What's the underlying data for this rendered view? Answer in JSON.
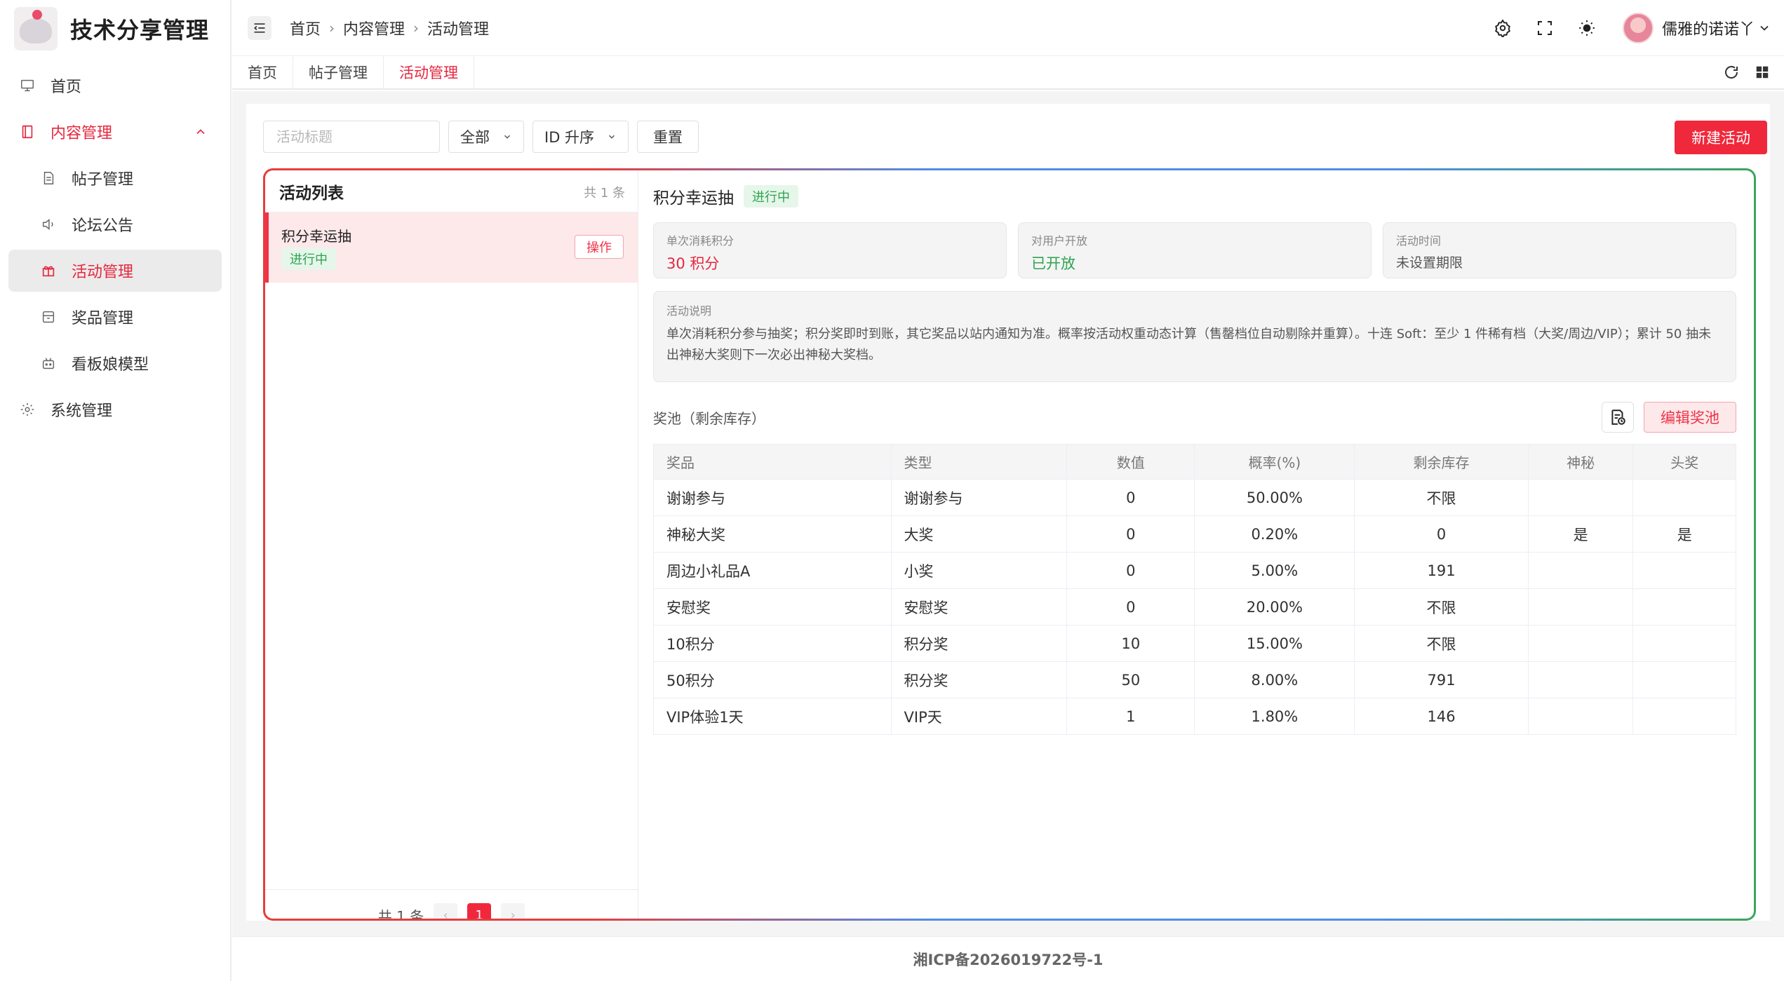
{
  "app": {
    "title": "技术分享管理"
  },
  "sidebar": {
    "items": [
      {
        "label": "首页"
      },
      {
        "label": "内容管理"
      },
      {
        "label": "帖子管理"
      },
      {
        "label": "论坛公告"
      },
      {
        "label": "活动管理"
      },
      {
        "label": "奖品管理"
      },
      {
        "label": "看板娘模型"
      },
      {
        "label": "系统管理"
      }
    ]
  },
  "header": {
    "breadcrumb": [
      "首页",
      "内容管理",
      "活动管理"
    ],
    "username": "儒雅的诺诺丫"
  },
  "tabs": [
    "首页",
    "帖子管理",
    "活动管理"
  ],
  "filters": {
    "search_placeholder": "活动标题",
    "status_select": "全部",
    "sort_select": "ID 升序",
    "reset_label": "重置",
    "new_label": "新建活动"
  },
  "list": {
    "title": "活动列表",
    "count": "共 1 条",
    "items": [
      {
        "name": "积分幸运抽",
        "status": "进行中",
        "action": "操作"
      }
    ],
    "pager": {
      "total": "共 1 条",
      "current": "1"
    }
  },
  "detail": {
    "name": "积分幸运抽",
    "status": "进行中",
    "cards": [
      {
        "label": "单次消耗积分",
        "value": "30 积分",
        "color": "#e6273e"
      },
      {
        "label": "对用户开放",
        "value": "已开放",
        "color": "#2ea44f"
      },
      {
        "label": "活动时间",
        "value": "未设置期限",
        "color": "#555555"
      }
    ],
    "desc_label": "活动说明",
    "desc_text": "单次消耗积分参与抽奖；积分奖即时到账，其它奖品以站内通知为准。概率按活动权重动态计算（售罄档位自动剔除并重算）。十连 Soft：至少 1 件稀有档（大奖/周边/VIP）；累计 50 抽未出神秘大奖则下一次必出神秘大奖档。",
    "pool_title": "奖池（剩余库存）",
    "edit_label": "编辑奖池",
    "columns": [
      "奖品",
      "类型",
      "数值",
      "概率(%)",
      "剩余库存",
      "神秘",
      "头奖"
    ],
    "rows": [
      [
        "谢谢参与",
        "谢谢参与",
        "0",
        "50.00%",
        "不限",
        "",
        ""
      ],
      [
        "神秘大奖",
        "大奖",
        "0",
        "0.20%",
        "0",
        "是",
        "是"
      ],
      [
        "周边小礼品A",
        "小奖",
        "0",
        "5.00%",
        "191",
        "",
        ""
      ],
      [
        "安慰奖",
        "安慰奖",
        "0",
        "20.00%",
        "不限",
        "",
        ""
      ],
      [
        "10积分",
        "积分奖",
        "10",
        "15.00%",
        "不限",
        "",
        ""
      ],
      [
        "50积分",
        "积分奖",
        "50",
        "8.00%",
        "791",
        "",
        ""
      ],
      [
        "VIP体验1天",
        "VIP天",
        "1",
        "1.80%",
        "146",
        "",
        ""
      ]
    ]
  },
  "footer": {
    "icp": "湘ICP备2026019722号-1"
  },
  "colors": {
    "accent": "#f0283c",
    "success": "#2ea44f"
  }
}
